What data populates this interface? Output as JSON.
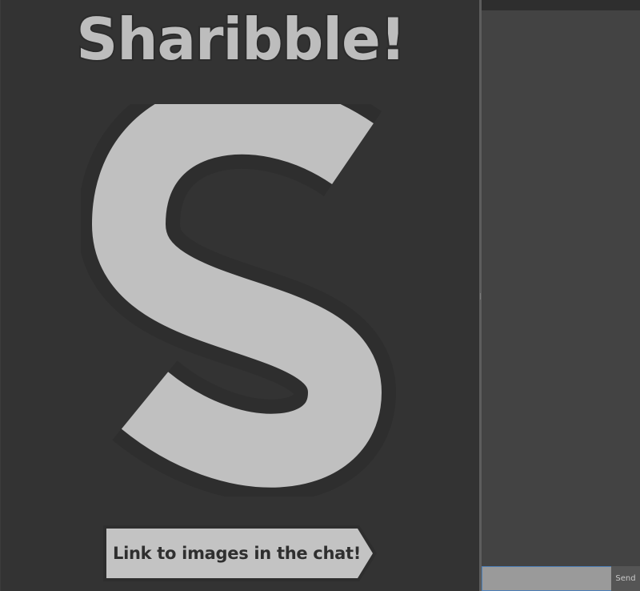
{
  "app": {
    "title": "Sharibble!",
    "logo_letter": "S",
    "cta_label": "Link to images in the chat!"
  },
  "chat": {
    "input_value": "",
    "send_label": "Send"
  },
  "colors": {
    "background": "#333333",
    "logo_fill": "#c0c0c0",
    "chat_background": "#434343",
    "input_focus_border": "#4d7fb8"
  }
}
